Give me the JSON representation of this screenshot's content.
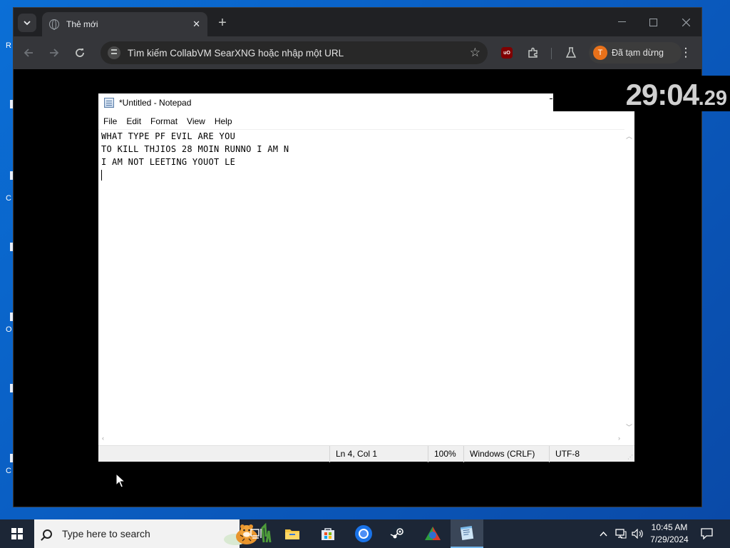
{
  "browser": {
    "tab_title": "Thẻ mới",
    "omnibox_placeholder": "Tìm kiếm CollabVM SearXNG hoặc nhập một URL",
    "profile_initial": "T",
    "profile_label": "Đã tạm dừng",
    "extension_label": "uO",
    "colors": {
      "frame": "#202124",
      "toolbar": "#35363a",
      "avatar": "#e8711a"
    }
  },
  "notepad": {
    "title": "*Untitled - Notepad",
    "menu": [
      "File",
      "Edit",
      "Format",
      "View",
      "Help"
    ],
    "lines": [
      "WHAT TYPE PF EVIL ARE YOU",
      "TO KILL THJIOS 28 MOIN RUNNO I AM N",
      "I AM NOT LEETING YOUOT LE"
    ],
    "status": {
      "position": "Ln 4, Col 1",
      "zoom": "100%",
      "line_ending": "Windows (CRLF)",
      "encoding": "UTF-8"
    }
  },
  "timer": {
    "main": "29:04",
    "fraction": ".29"
  },
  "taskbar": {
    "search_placeholder": "Type here to search",
    "time": "10:45 AM",
    "date": "7/29/2024",
    "apps": [
      "task-view",
      "file-explorer",
      "microsoft-store",
      "chrome",
      "steam",
      "xbox-app",
      "notepad"
    ]
  },
  "desktop": {
    "icon_fragments": [
      "R",
      "C",
      "O",
      "C"
    ]
  }
}
